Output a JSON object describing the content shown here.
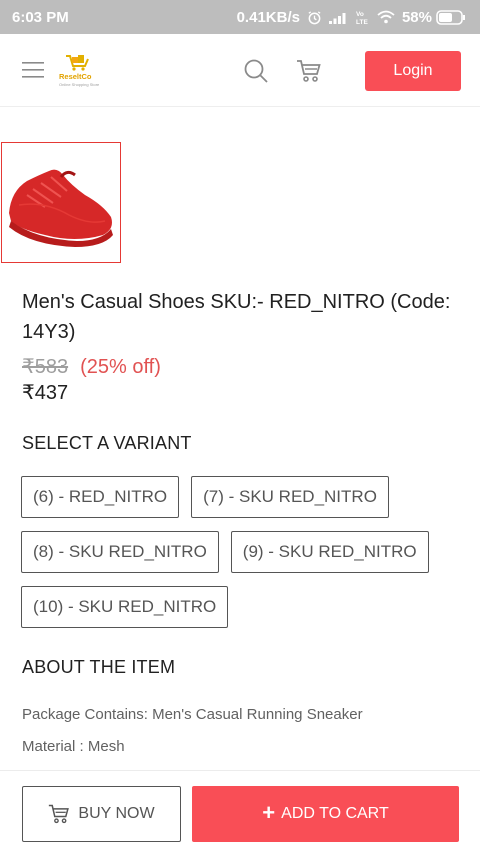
{
  "statusbar": {
    "time": "6:03 PM",
    "network_speed": "0.41KB/s",
    "battery": "58%"
  },
  "header": {
    "logo_text": "ReseltCo",
    "logo_tagline": "Online Shopping Store",
    "login_label": "Login",
    "icons": [
      "menu-icon",
      "search-icon",
      "cart-icon"
    ]
  },
  "product": {
    "title": "Men's Casual Shoes SKU:- RED_NITRO (Code: 14Y3)",
    "mrp": "₹583",
    "discount": "(25% off)",
    "price": "₹437",
    "image_color": "#d62828"
  },
  "variants": {
    "heading": "SELECT A VARIANT",
    "items": [
      "(6) - RED_NITRO",
      "(7) - SKU RED_NITRO",
      "(8) - SKU RED_NITRO",
      "(9) - SKU RED_NITRO",
      "(10) - SKU RED_NITRO"
    ]
  },
  "about": {
    "heading": "ABOUT THE ITEM",
    "package": "Package Contains: Men's Casual Running Sneaker",
    "material": "Material : Mesh"
  },
  "actions": {
    "buy_now": "BUY NOW",
    "add_to_cart": "ADD TO CART"
  },
  "colors": {
    "accent": "#f94e56",
    "status_bar": "#bdbdbd"
  }
}
